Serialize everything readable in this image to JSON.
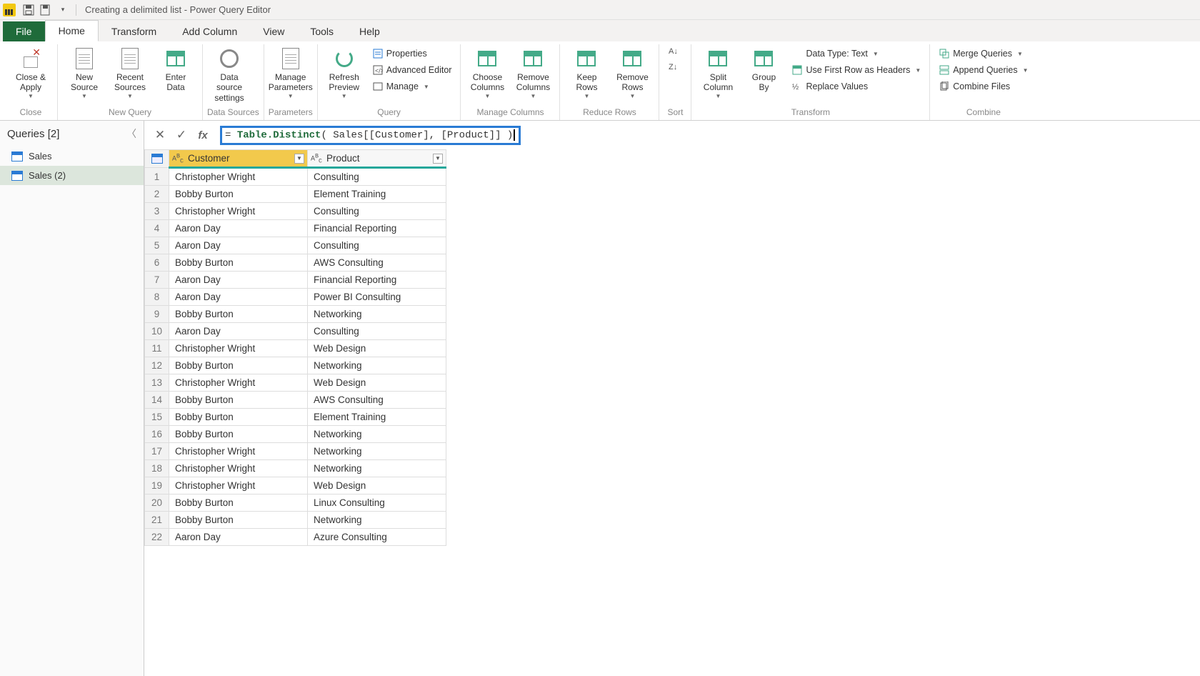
{
  "title": "Creating a delimited list - Power Query Editor",
  "tabs": [
    "File",
    "Home",
    "Transform",
    "Add Column",
    "View",
    "Tools",
    "Help"
  ],
  "activeTab": "Home",
  "ribbonGroups": [
    {
      "label": "Close",
      "big": [
        {
          "id": "close-apply",
          "label": "Close &\nApply",
          "dd": true
        }
      ]
    },
    {
      "label": "New Query",
      "big": [
        {
          "id": "new-source",
          "label": "New\nSource",
          "dd": true
        },
        {
          "id": "recent-sources",
          "label": "Recent\nSources",
          "dd": true
        },
        {
          "id": "enter-data",
          "label": "Enter\nData",
          "dd": false
        }
      ]
    },
    {
      "label": "Data Sources",
      "big": [
        {
          "id": "data-source-settings",
          "label": "Data source\nsettings",
          "dd": false
        }
      ]
    },
    {
      "label": "Parameters",
      "big": [
        {
          "id": "manage-parameters",
          "label": "Manage\nParameters",
          "dd": true
        }
      ]
    },
    {
      "label": "Query",
      "big": [
        {
          "id": "refresh-preview",
          "label": "Refresh\nPreview",
          "dd": true
        }
      ],
      "small": [
        {
          "id": "properties",
          "label": "Properties"
        },
        {
          "id": "advanced-editor",
          "label": "Advanced Editor"
        },
        {
          "id": "manage",
          "label": "Manage",
          "dd": true
        }
      ]
    },
    {
      "label": "Manage Columns",
      "big": [
        {
          "id": "choose-columns",
          "label": "Choose\nColumns",
          "dd": true
        },
        {
          "id": "remove-columns",
          "label": "Remove\nColumns",
          "dd": true
        }
      ]
    },
    {
      "label": "Reduce Rows",
      "big": [
        {
          "id": "keep-rows",
          "label": "Keep\nRows",
          "dd": true
        },
        {
          "id": "remove-rows",
          "label": "Remove\nRows",
          "dd": true
        }
      ]
    },
    {
      "label": "Sort",
      "big": [
        {
          "id": "sort",
          "label": "",
          "dd": false,
          "narrow": true
        }
      ]
    },
    {
      "label": "Transform",
      "big": [
        {
          "id": "split-column",
          "label": "Split\nColumn",
          "dd": true
        },
        {
          "id": "group-by",
          "label": "Group\nBy",
          "dd": false
        }
      ],
      "small": [
        {
          "id": "data-type",
          "label": "Data Type: Text",
          "dd": true
        },
        {
          "id": "first-row-headers",
          "label": "Use First Row as Headers",
          "dd": true
        },
        {
          "id": "replace-values",
          "label": "Replace Values"
        }
      ]
    },
    {
      "label": "Combine",
      "small": [
        {
          "id": "merge-queries",
          "label": "Merge Queries",
          "dd": true
        },
        {
          "id": "append-queries",
          "label": "Append Queries",
          "dd": true
        },
        {
          "id": "combine-files",
          "label": "Combine Files"
        }
      ]
    }
  ],
  "queriesPane": {
    "header": "Queries [2]",
    "items": [
      {
        "name": "Sales",
        "selected": false
      },
      {
        "name": "Sales (2)",
        "selected": true
      }
    ]
  },
  "formula": {
    "prefixEq": "= ",
    "func": "Table.Distinct",
    "open": "( ",
    "args": "Sales[[Customer], [Product]]",
    "close": " )"
  },
  "columns": [
    {
      "name": "Customer",
      "selected": true
    },
    {
      "name": "Product",
      "selected": false
    }
  ],
  "rows": [
    {
      "c": "Christopher Wright",
      "p": "Consulting"
    },
    {
      "c": "Bobby Burton",
      "p": "Element Training"
    },
    {
      "c": "Christopher Wright",
      "p": "Consulting"
    },
    {
      "c": "Aaron Day",
      "p": "Financial Reporting"
    },
    {
      "c": "Aaron Day",
      "p": "Consulting"
    },
    {
      "c": "Bobby Burton",
      "p": "AWS Consulting"
    },
    {
      "c": "Aaron Day",
      "p": "Financial Reporting"
    },
    {
      "c": "Aaron Day",
      "p": "Power BI Consulting"
    },
    {
      "c": "Bobby Burton",
      "p": "Networking"
    },
    {
      "c": "Aaron Day",
      "p": "Consulting"
    },
    {
      "c": "Christopher Wright",
      "p": "Web Design"
    },
    {
      "c": "Bobby Burton",
      "p": "Networking"
    },
    {
      "c": "Christopher Wright",
      "p": "Web Design"
    },
    {
      "c": "Bobby Burton",
      "p": "AWS Consulting"
    },
    {
      "c": "Bobby Burton",
      "p": "Element Training"
    },
    {
      "c": "Bobby Burton",
      "p": "Networking"
    },
    {
      "c": "Christopher Wright",
      "p": "Networking"
    },
    {
      "c": "Christopher Wright",
      "p": "Networking"
    },
    {
      "c": "Christopher Wright",
      "p": "Web Design"
    },
    {
      "c": "Bobby Burton",
      "p": "Linux Consulting"
    },
    {
      "c": "Bobby Burton",
      "p": "Networking"
    },
    {
      "c": "Aaron Day",
      "p": "Azure Consulting"
    }
  ]
}
